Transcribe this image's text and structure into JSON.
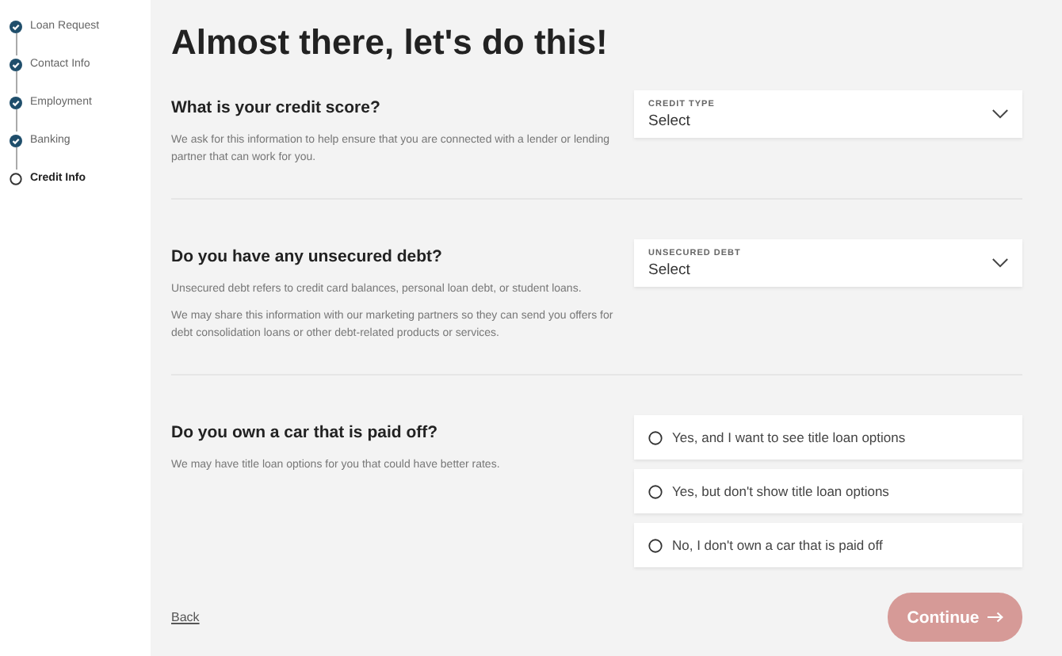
{
  "steps": [
    {
      "label": "Loan Request",
      "done": true,
      "selected": false
    },
    {
      "label": "Contact Info",
      "done": true,
      "selected": false
    },
    {
      "label": "Employment",
      "done": true,
      "selected": false
    },
    {
      "label": "Banking",
      "done": true,
      "selected": false
    },
    {
      "label": "Credit Info",
      "done": false,
      "selected": true
    }
  ],
  "title": "Almost there, let's do this!",
  "sections": [
    {
      "kind": "select",
      "question": "What is your credit score?",
      "paragraphs": [
        "We ask for this information to help ensure that you are connected with a lender or lending partner that can work for you."
      ],
      "field_label": "CREDIT TYPE",
      "value": "Select"
    },
    {
      "kind": "select",
      "question": "Do you have any unsecured debt?",
      "paragraphs": [
        "Unsecured debt refers to credit card balances, personal loan debt, or student loans.",
        "We may share this information with our marketing partners so they can send you offers for debt consolidation loans or other debt-related products or services."
      ],
      "field_label": "UNSECURED DEBT",
      "value": "Select"
    },
    {
      "kind": "radio",
      "question": "Do you own a car that is paid off?",
      "paragraphs": [
        "We may have title loan options for you that could have better rates."
      ],
      "options": [
        {
          "label": "Yes, and I want to see title loan options",
          "selected": false
        },
        {
          "label": "Yes, but don't show title loan options",
          "selected": false
        },
        {
          "label": "No, I don't own a car that is paid off",
          "selected": false
        }
      ]
    }
  ],
  "back": "Back",
  "continue": {
    "label": "Continue",
    "disabled": true
  }
}
